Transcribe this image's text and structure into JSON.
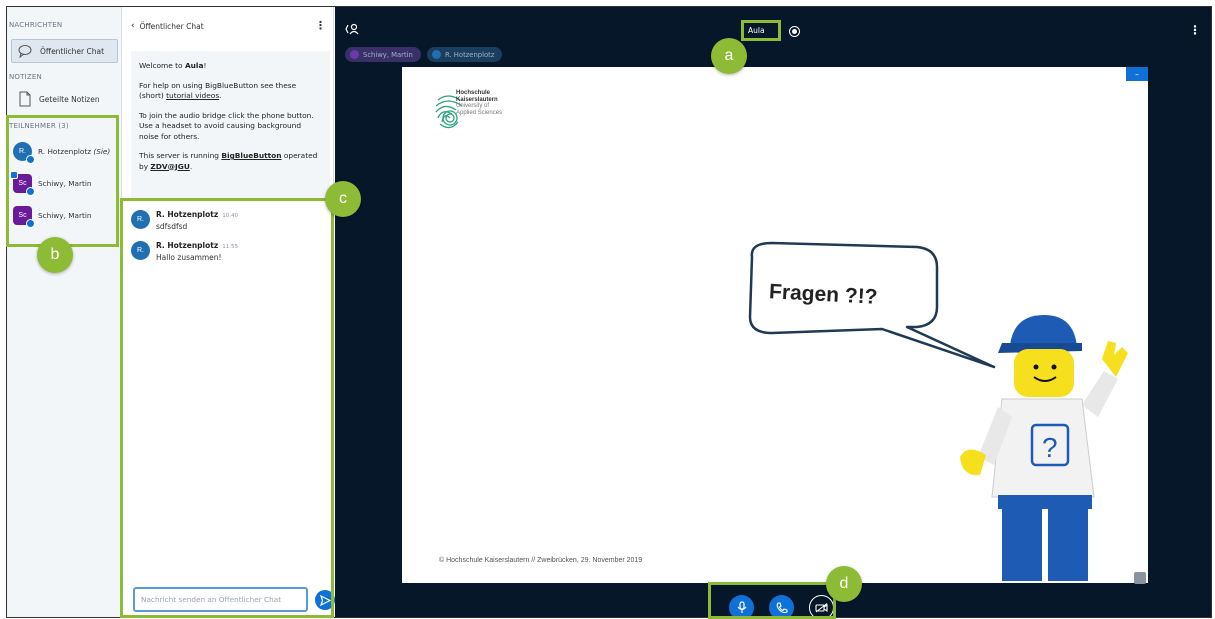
{
  "userlist": {
    "messages_title": "NACHRICHTEN",
    "public_chat_label": "Öffentlicher Chat",
    "notes_title": "NOTIZEN",
    "shared_notes_label": "Geteilte Notizen",
    "participants_title": "TEILNEHMER (3)",
    "participants": [
      {
        "initials": "R.",
        "name": "R. Hotzenplotz",
        "suffix": "(Sie)",
        "color": "#1f6fb2"
      },
      {
        "initials": "Sc",
        "name": "Schiwy, Martin",
        "suffix": "",
        "color": "#6a1b9a"
      },
      {
        "initials": "Sc",
        "name": "Schiwy, Martin",
        "suffix": "",
        "color": "#6a1b9a"
      }
    ]
  },
  "chat": {
    "header": "Öffentlicher Chat",
    "back_icon": "chevron-left-icon",
    "welcome": {
      "line1_pre": "Welcome to ",
      "line1_room": "Aula",
      "line1_post": "!",
      "line2_pre": "For help on using BigBlueButton see these (short) ",
      "line2_link": "tutorial videos",
      "line2_post": ".",
      "line3": "To join the audio bridge click the phone button. Use a headset to avoid causing background noise for others.",
      "line4_pre": "This server is running ",
      "line4_link": "BigBlueButton",
      "line4_mid": " operated by ",
      "line4_org": "ZDV@JGU",
      "line4_post": "."
    },
    "messages": [
      {
        "initials": "R.",
        "name": "R. Hotzenplotz",
        "time": "10:40",
        "text": "sdfsdfsd"
      },
      {
        "initials": "R.",
        "name": "R. Hotzenplotz",
        "time": "11:55",
        "text": "Hallo zusammen!"
      }
    ],
    "input_placeholder": "Nachricht senden an Öffentlicher Chat"
  },
  "main": {
    "room_title": "Aula",
    "talkers": [
      {
        "name": "Schiwy, Martin",
        "color": "#6a3aa8"
      },
      {
        "name": "R. Hotzenplotz",
        "color": "#1f6fb2"
      }
    ],
    "slide": {
      "logo_line1": "Hochschule",
      "logo_line2": "Kaiserslautern",
      "logo_line3": "University of",
      "logo_line4": "Applied Sciences",
      "bubble_text": "Fragen ?!?",
      "footer": "© Hochschule Kaiserslautern  //  Zweibrücken, 29. November 2019",
      "min_label": "–"
    }
  },
  "annotations": {
    "a": "a",
    "b": "b",
    "c": "c",
    "d": "d"
  },
  "colors": {
    "accent": "#0f70d7",
    "annotation": "#8dbb35",
    "main_bg": "#06172a"
  }
}
